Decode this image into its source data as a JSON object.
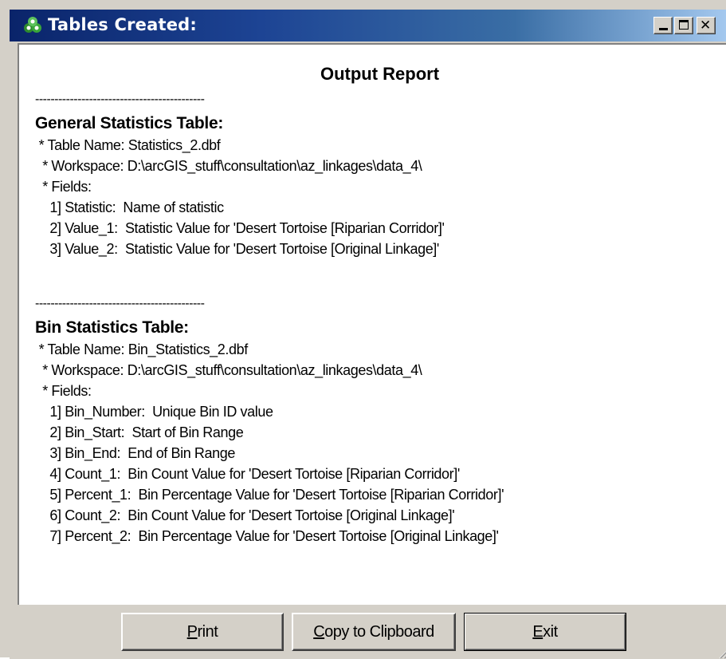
{
  "window": {
    "title": "Tables Created:"
  },
  "report": {
    "title": "Output Report",
    "separator": "--------------------------------------------",
    "sections": [
      {
        "heading": "General Statistics Table:",
        "lines": [
          " * Table Name: Statistics_2.dbf",
          "  * Workspace: D:\\arcGIS_stuff\\consultation\\az_linkages\\data_4\\",
          "  * Fields:",
          "    1] Statistic:  Name of statistic",
          "    2] Value_1:  Statistic Value for 'Desert Tortoise [Riparian Corridor]'",
          "    3] Value_2:  Statistic Value for 'Desert Tortoise [Original Linkage]'"
        ]
      },
      {
        "heading": "Bin Statistics Table:",
        "lines": [
          " * Table Name: Bin_Statistics_2.dbf",
          "  * Workspace: D:\\arcGIS_stuff\\consultation\\az_linkages\\data_4\\",
          "  * Fields:",
          "    1] Bin_Number:  Unique Bin ID value",
          "    2] Bin_Start:  Start of Bin Range",
          "    3] Bin_End:  End of Bin Range",
          "    4] Count_1:  Bin Count Value for 'Desert Tortoise [Riparian Corridor]'",
          "    5] Percent_1:  Bin Percentage Value for 'Desert Tortoise [Riparian Corridor]'",
          "    6] Count_2:  Bin Count Value for 'Desert Tortoise [Original Linkage]'",
          "    7] Percent_2:  Bin Percentage Value for 'Desert Tortoise [Original Linkage]'"
        ]
      }
    ]
  },
  "buttons": {
    "print": {
      "mnemonic": "P",
      "rest": "rint"
    },
    "copy": {
      "mnemonic": "C",
      "rest": "opy to Clipboard"
    },
    "exit": {
      "mnemonic": "E",
      "rest": "xit"
    }
  },
  "colors": {
    "titlebar_start": "#0a246a",
    "titlebar_end": "#a6caf0",
    "face": "#d4d0c8"
  },
  "icons": {
    "app": "arcgis-toolbox-icon",
    "minimize": "minimize-icon",
    "maximize": "maximize-icon",
    "close": "close-icon"
  }
}
